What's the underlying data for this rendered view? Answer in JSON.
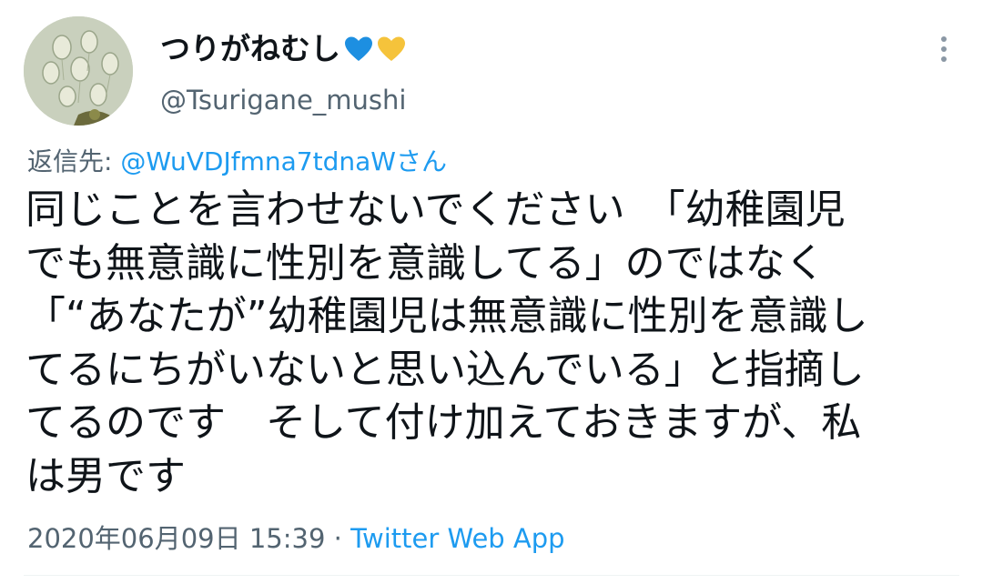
{
  "author": {
    "display_name": "つりがねむし",
    "handle": "@Tsurigane_mushi",
    "emoji": [
      "blue-heart",
      "yellow-heart"
    ]
  },
  "reply": {
    "prefix": "返信先: ",
    "mention": "@WuVDJfmna7tdnaWさん"
  },
  "tweet": {
    "lines": [
      "同じことを言わせないでください　「幼稚園児",
      "でも無意識に性別を意識してる」のではなく",
      "「“あなたが”幼稚園児は無意識に性別を意識し",
      "てるにちがいないと思い込んでいる」と指摘し",
      "てるのです　そして付け加えておきますが、私",
      "は男です"
    ]
  },
  "meta": {
    "timestamp": "2020年06月09日 15:39",
    "separator": " · ",
    "source": "Twitter Web App"
  },
  "colors": {
    "text": "#0f1419",
    "secondary": "#536471",
    "accent": "#1d9bf0",
    "blue_heart": "#1d8fe1",
    "yellow_heart": "#f5c33b"
  }
}
